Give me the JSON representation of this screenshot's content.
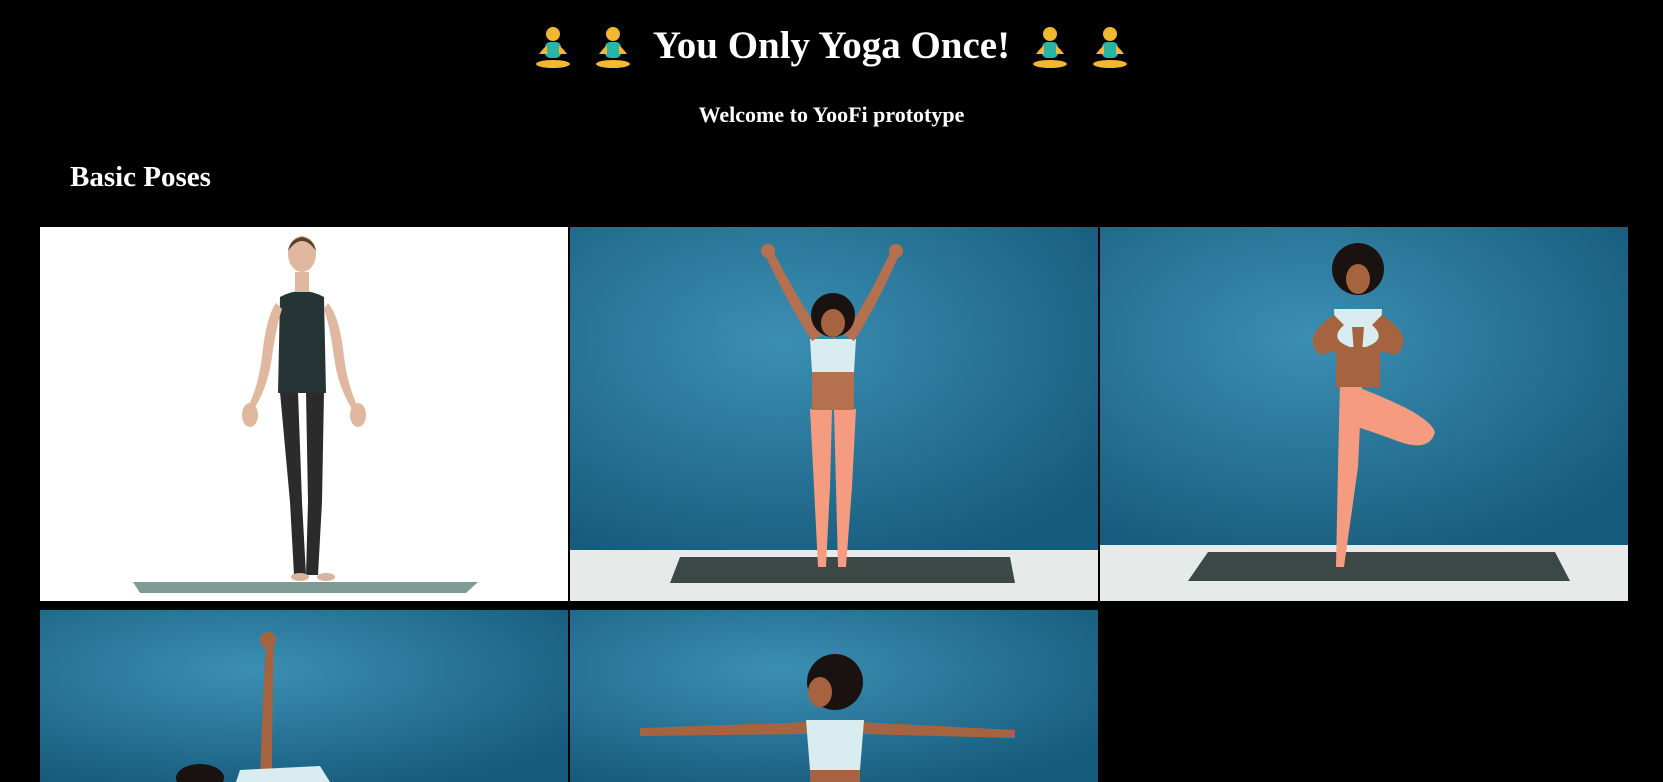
{
  "header": {
    "title": "You Only Yoga Once!",
    "title_emoji": "person-in-lotus-position-emoji"
  },
  "subtitle": "Welcome to YooFi prototype",
  "section": {
    "title": "Basic Poses"
  },
  "colors": {
    "background": "#000000",
    "text": "#ffffff",
    "studio_blue": "#1f6a8e",
    "floor": "#e8eceb",
    "mat": "#3b4846",
    "leggings": "#f59c80",
    "top": "#d9ecf0"
  },
  "poses": [
    {
      "id": "pose-1",
      "image": "woman-standing-on-white-background"
    },
    {
      "id": "pose-2",
      "image": "woman-arms-raised-blue-backdrop"
    },
    {
      "id": "pose-3",
      "image": "woman-tree-pose-blue-backdrop"
    },
    {
      "id": "pose-4",
      "image": "woman-side-plank-blue-backdrop"
    },
    {
      "id": "pose-5",
      "image": "woman-warrior-arms-extended-blue-backdrop"
    }
  ]
}
